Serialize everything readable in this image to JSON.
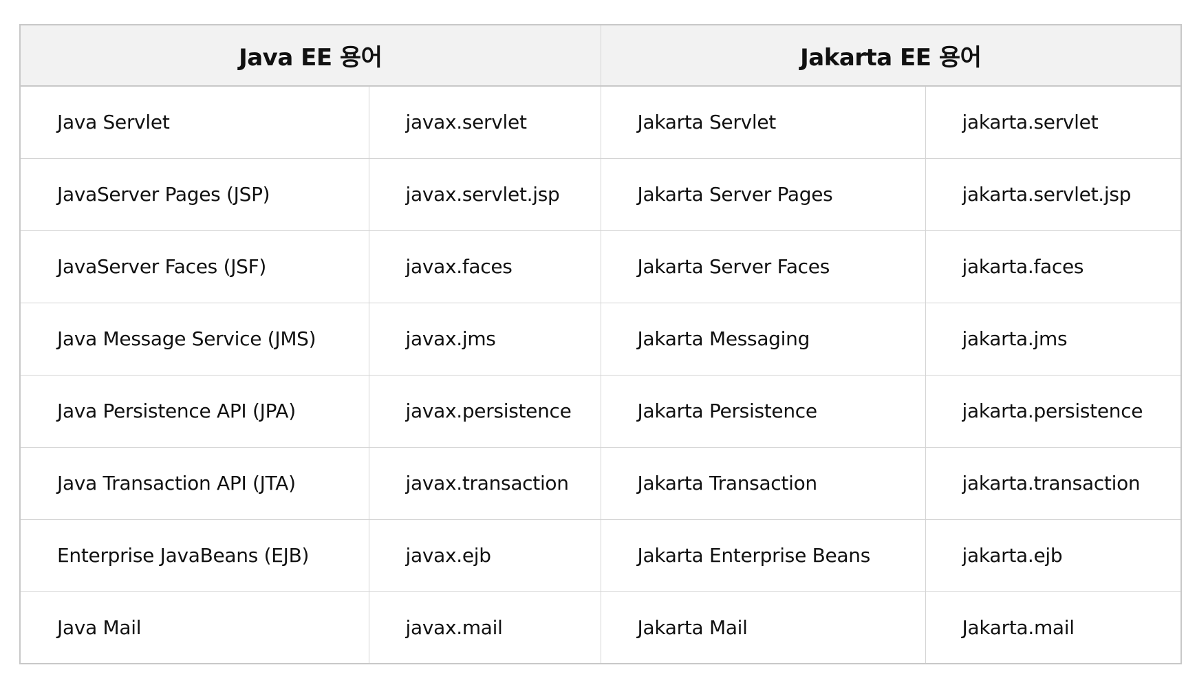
{
  "table": {
    "headers": [
      "Java EE 용어",
      "Jakarta EE 용어"
    ],
    "rows": [
      [
        "Java Servlet",
        "javax.servlet",
        "Jakarta Servlet",
        "jakarta.servlet"
      ],
      [
        "JavaServer Pages (JSP)",
        "javax.servlet.jsp",
        "Jakarta Server Pages",
        "jakarta.servlet.jsp"
      ],
      [
        "JavaServer Faces (JSF)",
        "javax.faces",
        "Jakarta Server Faces",
        "jakarta.faces"
      ],
      [
        "Java Message Service (JMS)",
        "javax.jms",
        "Jakarta Messaging",
        "jakarta.jms"
      ],
      [
        "Java Persistence API (JPA)",
        "javax.persistence",
        "Jakarta Persistence",
        "jakarta.persistence"
      ],
      [
        "Java Transaction API (JTA)",
        "javax.transaction",
        "Jakarta Transaction",
        "jakarta.transaction"
      ],
      [
        "Enterprise JavaBeans (EJB)",
        "javax.ejb",
        "Jakarta Enterprise Beans",
        "jakarta.ejb"
      ],
      [
        "Java Mail",
        "javax.mail",
        "Jakarta Mail",
        "Jakarta.mail"
      ]
    ]
  }
}
